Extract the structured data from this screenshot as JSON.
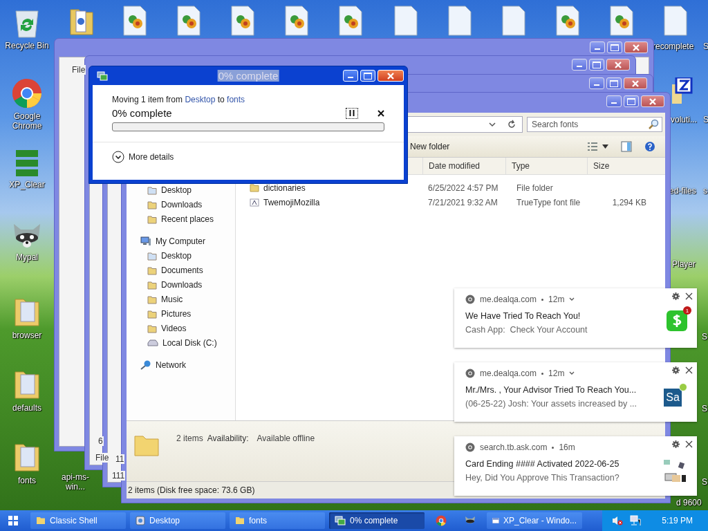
{
  "desktop": {
    "icons": [
      {
        "label": "Recycle Bin",
        "kind": "recycle"
      },
      {
        "label": "Google Chrome",
        "kind": "chrome"
      },
      {
        "label": "XP_Clear",
        "kind": "shortcut"
      },
      {
        "label": "Mypal",
        "kind": "raccoon"
      },
      {
        "label": "browser",
        "kind": "folder"
      },
      {
        "label": "defaults",
        "kind": "folder"
      },
      {
        "label": "fonts",
        "kind": "folder"
      },
      {
        "label": "api-ms-win...",
        "kind": "none"
      }
    ],
    "edge_labels": [
      "recomplete",
      "S",
      "voluti...",
      "S",
      "ed-files",
      "s",
      "Player",
      "S",
      "S",
      "S",
      "d 9600"
    ]
  },
  "background_windows": [
    {
      "fragments": [
        "File"
      ]
    },
    {
      "fragments": [
        "6",
        "File"
      ]
    },
    {
      "fragments": [
        "11",
        "111"
      ]
    }
  ],
  "explorer": {
    "search": {
      "placeholder": "Search fonts"
    },
    "toolbar": {
      "new_folder": "New folder"
    },
    "columns": [
      "Date modified",
      "Type",
      "Size"
    ],
    "favorites": [
      {
        "label": "Desktop",
        "kind": "desktop"
      },
      {
        "label": "Downloads",
        "kind": "folder"
      },
      {
        "label": "Recent places",
        "kind": "folder"
      }
    ],
    "tree": [
      {
        "label": "My Computer",
        "kind": "computer",
        "children": [
          {
            "label": "Desktop",
            "kind": "desktop"
          },
          {
            "label": "Documents",
            "kind": "folder"
          },
          {
            "label": "Downloads",
            "kind": "folder"
          },
          {
            "label": "Music",
            "kind": "folder"
          },
          {
            "label": "Pictures",
            "kind": "folder"
          },
          {
            "label": "Videos",
            "kind": "folder"
          },
          {
            "label": "Local Disk (C:)",
            "kind": "disk"
          }
        ]
      },
      {
        "label": "Network",
        "kind": "network"
      }
    ],
    "files": [
      {
        "name": "dictionaries",
        "kind": "folder",
        "date": "6/25/2022 4:57 PM",
        "type": "File folder"
      },
      {
        "name": "TwemojiMozilla",
        "kind": "font",
        "date": "7/21/2021 9:32 AM",
        "type": "TrueType font file",
        "size": "1,294 KB"
      }
    ],
    "details": {
      "count": "2 items",
      "label": "Availability:",
      "value": "Available offline"
    },
    "status": "2 items (Disk free space: 73.6 GB)"
  },
  "dialog": {
    "title": "0% complete",
    "from_text": "Moving 1 item from",
    "from_link": "Desktop",
    "to_text": "to",
    "to_link": "fonts",
    "progress_label": "0% complete",
    "level": 0,
    "more": "More details"
  },
  "notifications": [
    {
      "site": "me.dealqa.com",
      "age": "12m",
      "expandable": true,
      "title": "We Have Tried To Reach You!",
      "body": "Cash App:  Check Your Account",
      "image": {
        "kind": "cashapp",
        "badge": "1"
      }
    },
    {
      "site": "me.dealqa.com",
      "age": "12m",
      "expandable": true,
      "title": "Mr./Mrs. , Your Advisor Tried To Reach You...",
      "body": "(06-25-22) Josh: Your assets increased by ...",
      "image": {
        "kind": "sa",
        "text": "Sa"
      }
    },
    {
      "site": "search.tb.ask.com",
      "age": "16m",
      "expandable": false,
      "title": "Card Ending #### Activated 2022-06-25",
      "body": "Hey, Did You Approve This Transaction?",
      "image": {
        "kind": "card"
      }
    }
  ],
  "taskbar": {
    "items": [
      {
        "label": "Classic Shell",
        "kind": "folder",
        "selected": false
      },
      {
        "label": "Desktop",
        "kind": "desktop",
        "selected": false
      },
      {
        "label": "fonts",
        "kind": "folder",
        "selected": false
      },
      {
        "label": "0% complete",
        "kind": "copy",
        "selected": true
      },
      {
        "kind": "chrome",
        "selected": false
      },
      {
        "kind": "raccoon",
        "selected": false
      },
      {
        "label": "XP_Clear - Windo...",
        "kind": "window",
        "selected": false
      }
    ],
    "clock": "5:19 PM"
  }
}
